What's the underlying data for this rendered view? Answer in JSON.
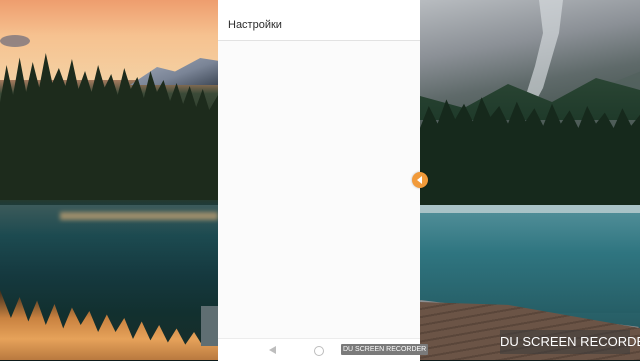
{
  "screen": {
    "title": "Настройки"
  },
  "nav": {
    "back_icon": "back-triangle-icon",
    "home_icon": "home-circle-icon"
  },
  "watermark": {
    "small_label": "DU SCREEN RECORDER",
    "large_label": "DU SCREEN RECORDER"
  },
  "floating": {
    "icon": "edge-handle-icon",
    "color": "#f19a3a"
  }
}
